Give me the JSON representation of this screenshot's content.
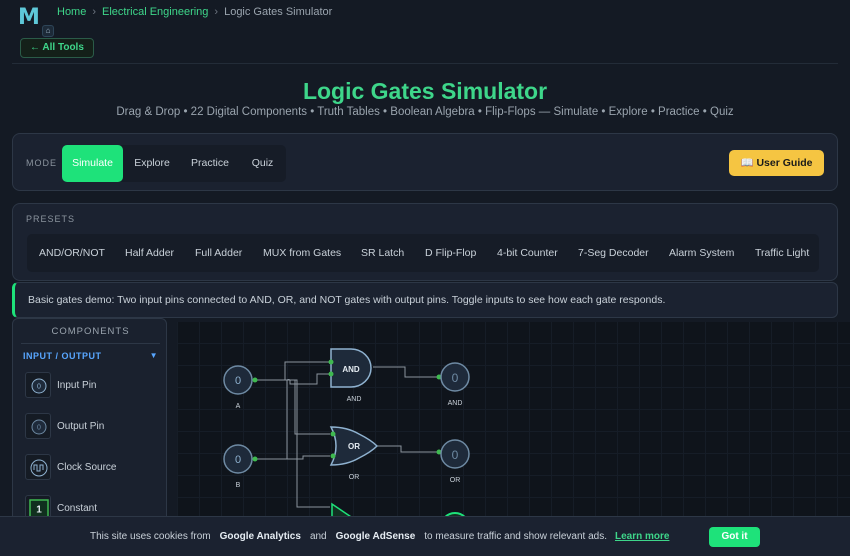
{
  "brand": {
    "logo_letter": "M",
    "badge_icon": "home-icon"
  },
  "breadcrumb": {
    "home": "Home",
    "category": "Electrical Engineering",
    "current": "Logic Gates Simulator",
    "separator": "›"
  },
  "all_tools": {
    "label": "← All Tools"
  },
  "header": {
    "title": "Logic Gates Simulator",
    "subtitle": "Drag & Drop • 22 Digital Components • Truth Tables • Boolean Algebra • Flip-Flops — Simulate • Explore • Practice • Quiz"
  },
  "mode": {
    "label": "MODE",
    "tabs": [
      {
        "label": "Simulate",
        "active": true
      },
      {
        "label": "Explore",
        "active": false
      },
      {
        "label": "Practice",
        "active": false
      },
      {
        "label": "Quiz",
        "active": false
      }
    ],
    "guide_label": "📖 User Guide"
  },
  "presets": {
    "label": "PRESETS",
    "items": [
      "AND/OR/NOT",
      "Half Adder",
      "Full Adder",
      "MUX from Gates",
      "SR Latch",
      "D Flip-Flop",
      "4-bit Counter",
      "7-Seg Decoder",
      "Alarm System",
      "Traffic Light"
    ]
  },
  "info": {
    "text": "Basic gates demo: Two input pins connected to AND, OR, and NOT gates with output pins. Toggle inputs to see how each gate responds."
  },
  "components": {
    "title": "COMPONENTS",
    "category": {
      "label": "INPUT / OUTPUT",
      "arrow": "▼"
    },
    "items": [
      {
        "name": "Input Pin",
        "icon": "input-pin-icon",
        "glyph": "0"
      },
      {
        "name": "Output Pin",
        "icon": "output-pin-icon",
        "glyph": "0"
      },
      {
        "name": "Clock Source",
        "icon": "clock-wave-icon",
        "glyph": ""
      },
      {
        "name": "Constant",
        "icon": "constant-icon",
        "glyph": "1"
      }
    ]
  },
  "circuit": {
    "inputs": [
      {
        "label": "A",
        "value": "0"
      },
      {
        "label": "B",
        "value": "0"
      }
    ],
    "gates": [
      {
        "type": "AND",
        "caption": "AND"
      },
      {
        "type": "OR",
        "caption": "OR"
      },
      {
        "type": "NOT",
        "caption": ""
      }
    ],
    "outputs": [
      {
        "label": "AND",
        "value": "0"
      },
      {
        "label": "OR",
        "value": "0"
      }
    ],
    "colors": {
      "wire": "#8b949e",
      "pin_dot": "#3fb950",
      "gate_fill": "#1e2a3a",
      "gate_stroke": "#8fb2d0",
      "active": "#1ee27a"
    }
  },
  "cookie": {
    "text1": "This site uses cookies from",
    "ga": "Google Analytics",
    "and": "and",
    "adsense": "Google AdSense",
    "text2": "to measure traffic and show relevant ads.",
    "learn_more": "Learn more",
    "got_it": "Got it"
  }
}
